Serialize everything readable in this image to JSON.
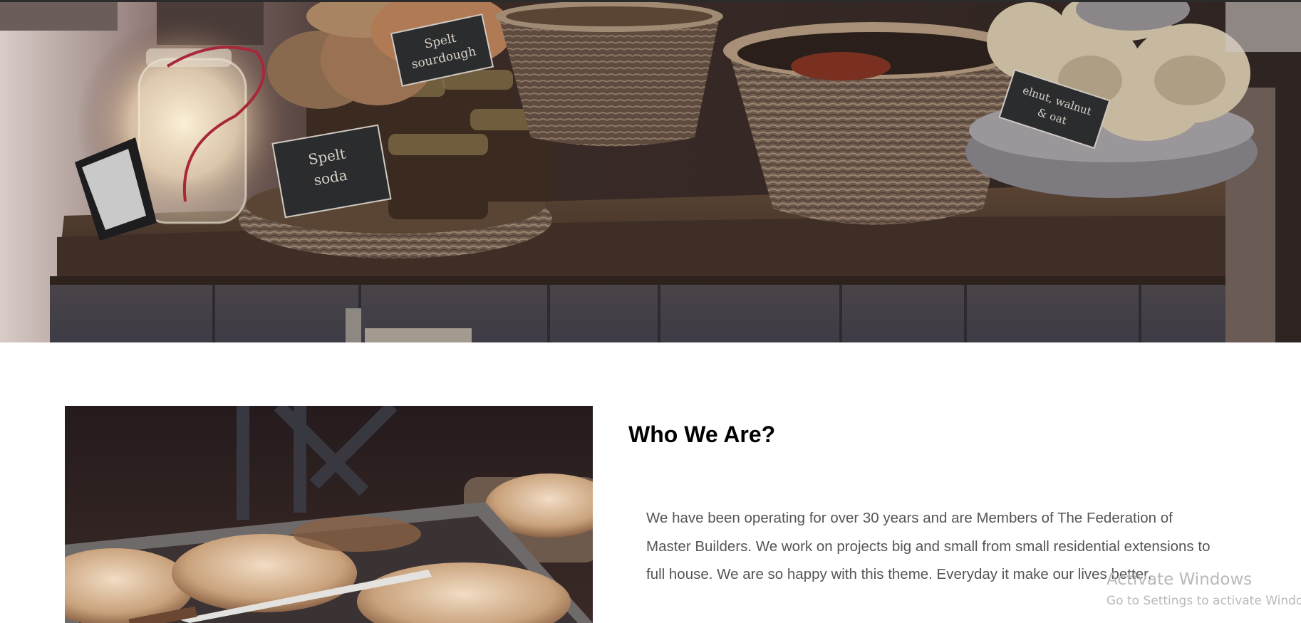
{
  "hero": {
    "image_name": "bakery-display-table",
    "signs": {
      "sign1_line1": "Spelt",
      "sign1_line2": "sourdough",
      "sign2_line1": "Spelt",
      "sign2_line2": "soda",
      "sign3_line1": "elnut, walnut",
      "sign3_line2": "& oat"
    }
  },
  "about": {
    "image_name": "bread-tray-photo",
    "title": "Who We Are?",
    "body": "We have been operating for over 30 years and are Members of The Federation of Master Builders. We work on projects big and small from small residential extensions to full house. We are so happy with this theme. Everyday it make our lives better."
  },
  "watermark": {
    "title": "Activate Windows",
    "subtitle": "Go to Settings to activate Windows."
  },
  "colors": {
    "heading": "#000000",
    "body_text": "#555555",
    "watermark": "#b9b9b9",
    "background": "#ffffff"
  }
}
